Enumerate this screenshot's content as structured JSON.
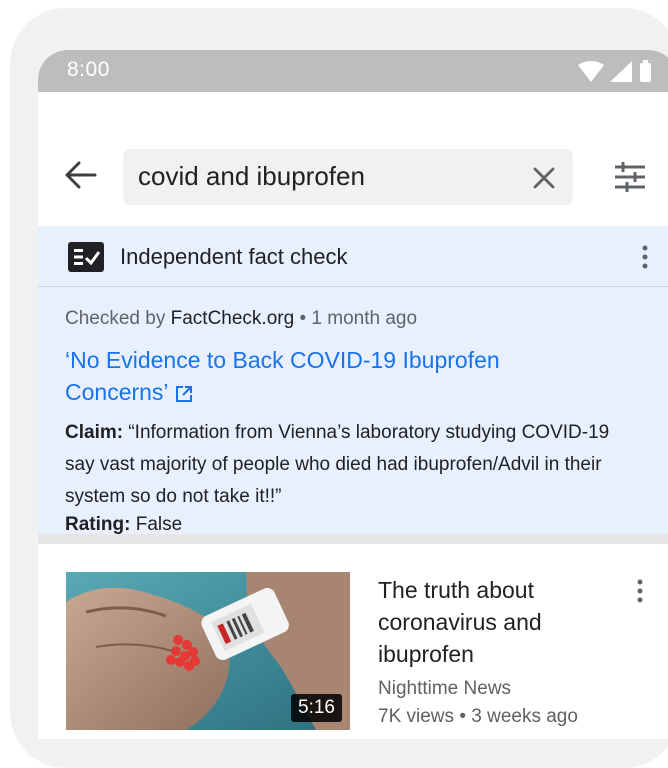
{
  "status_bar": {
    "time": "8:00",
    "icons": [
      "wifi-icon",
      "signal-icon",
      "battery-icon"
    ]
  },
  "search": {
    "query": "covid and ibuprofen",
    "icons": [
      "back-arrow-icon",
      "clear-icon",
      "filter-icon"
    ]
  },
  "fact_check": {
    "header_title": "Independent fact check",
    "checked_by_prefix": "Checked by",
    "publisher": "FactCheck.org",
    "separator": "•",
    "time_ago": "1 month ago",
    "article_title": "‘No Evidence to Back COVID-19 Ibuprofen Concerns’",
    "claim_label": "Claim:",
    "claim_text": "“Information from Vienna’s laboratory studying COVID-19 say vast majority of people who died had ibuprofen/Advil in their system so do not take it!!”",
    "rating_label": "Rating:",
    "rating_value": "False"
  },
  "video": {
    "title": "The truth about coronavirus and ibuprofen",
    "channel": "Nighttime News",
    "views": "7K views",
    "separator": "•",
    "age": "3 weeks ago",
    "duration": "5:16"
  },
  "colors": {
    "link": "#1a73e8",
    "card_bg": "#e8f0fe",
    "status_bar": "#bdbdbd"
  }
}
